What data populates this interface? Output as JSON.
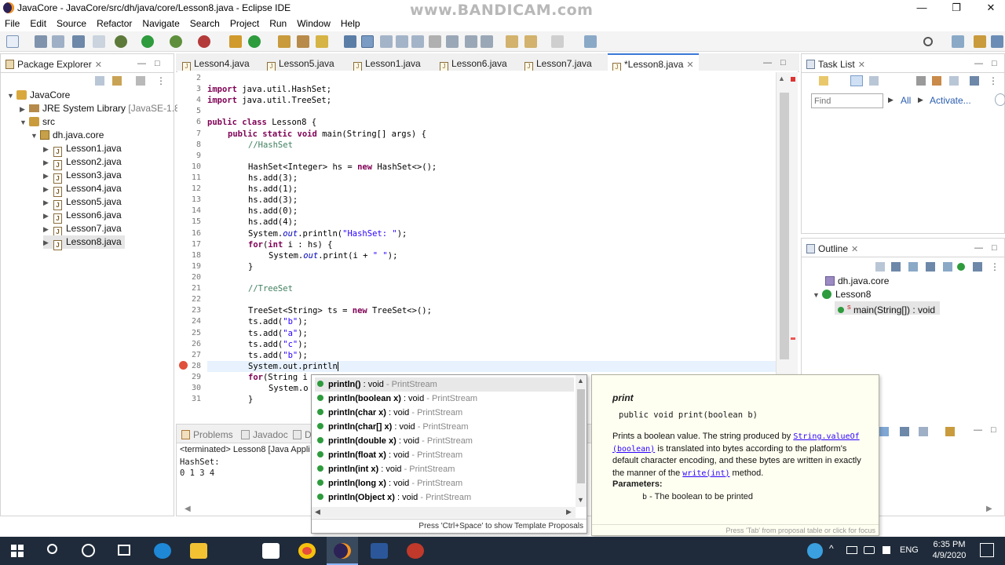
{
  "window": {
    "title": "JavaCore - JavaCore/src/dh/java/core/Lesson8.java - Eclipse IDE",
    "watermark": "www.BANDICAM.com"
  },
  "menu": [
    "File",
    "Edit",
    "Source",
    "Refactor",
    "Navigate",
    "Search",
    "Project",
    "Run",
    "Window",
    "Help"
  ],
  "package_explorer": {
    "title": "Package Explorer",
    "tree": {
      "project": "JavaCore",
      "jre": "JRE System Library",
      "jre_version": "[JavaSE-1.8]",
      "src": "src",
      "package": "dh.java.core",
      "files": [
        "Lesson1.java",
        "Lesson2.java",
        "Lesson3.java",
        "Lesson4.java",
        "Lesson5.java",
        "Lesson6.java",
        "Lesson7.java",
        "Lesson8.java"
      ]
    }
  },
  "editor": {
    "tabs": [
      "Lesson4.java",
      "Lesson5.java",
      "Lesson1.java",
      "Lesson6.java",
      "Lesson7.java",
      "*Lesson8.java"
    ],
    "line_numbers": [
      "2",
      "3",
      "4",
      "5",
      "6",
      "7",
      "8",
      "9",
      "10",
      "11",
      "12",
      "13",
      "14",
      "15",
      "16",
      "17",
      "18",
      "19",
      "20",
      "21",
      "22",
      "23",
      "24",
      "25",
      "26",
      "27",
      "28",
      "29",
      "30",
      "31"
    ],
    "code": {
      "l3_kw": "import",
      "l3_rest": " java.util.HashSet;",
      "l4_kw": "import",
      "l4_rest": " java.util.TreeSet;",
      "l6_kw1": "public",
      "l6_kw2": "class",
      "l6_rest": " Lesson8 {",
      "l7_kw1": "public",
      "l7_kw2": "static",
      "l7_kw3": "void",
      "l7_rest": " main(String[] args) {",
      "l8": "//HashSet",
      "l10_a": "HashSet<Integer> hs = ",
      "l10_kw": "new",
      "l10_b": " HashSet<>();",
      "l11": "hs.add(3);",
      "l12": "hs.add(1);",
      "l13": "hs.add(3);",
      "l14": "hs.add(0);",
      "l15": "hs.add(4);",
      "l16_a": "System.",
      "l16_f": "out",
      "l16_b": ".println(",
      "l16_s": "\"HashSet: \"",
      "l16_c": ");",
      "l17_kw1": "for",
      "l17_a": "(",
      "l17_kw2": "int",
      "l17_b": " i : hs) {",
      "l18_a": "System.",
      "l18_f": "out",
      "l18_b": ".print(i + ",
      "l18_s": "\" \"",
      "l18_c": ");",
      "l19": "}",
      "l21": "//TreeSet",
      "l23_a": "TreeSet<String> ts = ",
      "l23_kw": "new",
      "l23_b": " TreeSet<>();",
      "l24_a": "ts.add(",
      "l24_s": "\"b\"",
      "l24_b": ");",
      "l25_a": "ts.add(",
      "l25_s": "\"a\"",
      "l25_b": ");",
      "l26_a": "ts.add(",
      "l26_s": "\"c\"",
      "l26_b": ");",
      "l27_a": "ts.add(",
      "l27_s": "\"b\"",
      "l27_b": ");",
      "l28": "System.out.println",
      "l29_kw": "for",
      "l29_a": "(String i",
      "l30": "System.o",
      "l31": "}"
    }
  },
  "task_list": {
    "title": "Task List",
    "find_placeholder": "Find",
    "all": "All",
    "activate": "Activate..."
  },
  "outline": {
    "title": "Outline",
    "package": "dh.java.core",
    "class": "Lesson8",
    "method_marker": "S",
    "method": "main(String[]) : void"
  },
  "bottom": {
    "tabs": [
      "Problems",
      "Javadoc",
      "D"
    ],
    "terminated": "<terminated> Lesson8 [Java Appli",
    "console": [
      "HashSet:",
      "0 1 3 4"
    ]
  },
  "autocomplete": {
    "items": [
      {
        "name": "println()",
        "ret": " : void",
        "cls": " - PrintStream"
      },
      {
        "name": "println(boolean x)",
        "ret": " : void",
        "cls": " - PrintStream"
      },
      {
        "name": "println(char x)",
        "ret": " : void",
        "cls": " - PrintStream"
      },
      {
        "name": "println(char[] x)",
        "ret": " : void",
        "cls": " - PrintStream"
      },
      {
        "name": "println(double x)",
        "ret": " : void",
        "cls": " - PrintStream"
      },
      {
        "name": "println(float x)",
        "ret": " : void",
        "cls": " - PrintStream"
      },
      {
        "name": "println(int x)",
        "ret": " : void",
        "cls": " - PrintStream"
      },
      {
        "name": "println(long x)",
        "ret": " : void",
        "cls": " - PrintStream"
      },
      {
        "name": "println(Object x)",
        "ret": " : void",
        "cls": " - PrintStream"
      }
    ],
    "footer": "Press 'Ctrl+Space' to show Template Proposals"
  },
  "javadoc": {
    "heading": "print",
    "signature": "public void print(boolean b)",
    "desc_a": "Prints a boolean value. The string produced by ",
    "link1": "String.valueOf (boolean)",
    "desc_b": " is translated into bytes according to the platform's default character encoding, and these bytes are written in exactly the manner of the ",
    "link2": "write(int)",
    "desc_c": " method.",
    "params_label": "Parameters:",
    "param_name": "b",
    "param_desc": " - The boolean to be printed",
    "footer": "Press 'Tab' from proposal table or click for focus"
  },
  "taskbar": {
    "time": "6:35 PM",
    "date": "4/9/2020",
    "lang": "ENG"
  },
  "colors": {
    "keyword": "#7f0055",
    "comment": "#3f7f5f",
    "string": "#2a00ff",
    "field": "#0000c0",
    "taskbar": "#1f2b3a",
    "doc_bg": "#fffff1"
  }
}
